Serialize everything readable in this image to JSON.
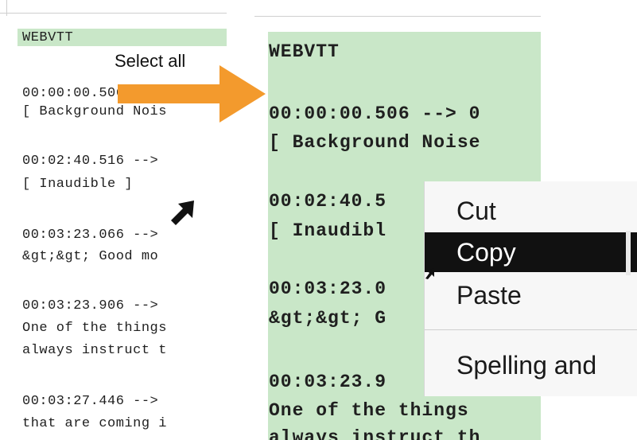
{
  "annotation": {
    "select_all": "Select all"
  },
  "left_panel": {
    "lines": [
      "WEBVTT",
      "00:00:00.506 -->",
      "[ Background Nois",
      "00:02:40.516 -->",
      "[ Inaudible ]",
      "00:03:23.066 -->",
      "&gt;&gt; Good mo",
      "00:03:23.906 -->",
      "One of the things",
      "always instruct t",
      "00:03:27.446 -->",
      "that are coming i"
    ]
  },
  "right_panel": {
    "lines": [
      "WEBVTT",
      "00:00:00.506 --> 0",
      "[ Background Noise",
      "00:02:40.5",
      "[ Inaudibl",
      "00:03:23.0",
      "&gt;&gt; G",
      "00:03:23.9",
      "One of the things",
      "always instruct th"
    ]
  },
  "context_menu": {
    "items": [
      "Cut",
      "Copy",
      "Paste",
      "Spelling and"
    ],
    "highlighted": "Copy"
  },
  "colors": {
    "selection_green": "#c9e7c8",
    "arrow_orange": "#f39a2d",
    "menu_highlight": "#111111"
  }
}
